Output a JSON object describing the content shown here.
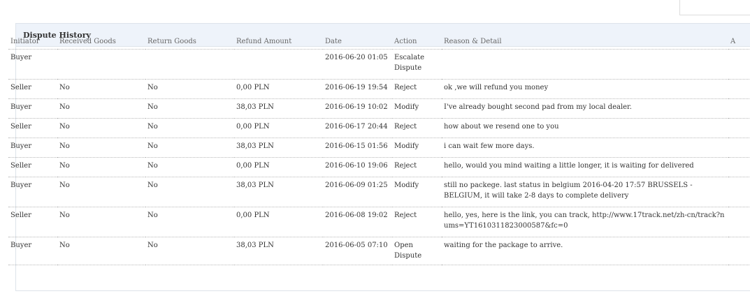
{
  "panel": {
    "title": "Dispute History"
  },
  "columns": [
    "Initiator",
    "Received Goods",
    "Return Goods",
    "Refund Amount",
    "Date",
    "Action",
    "Reason & Detail",
    "A"
  ],
  "rows": [
    {
      "initiator": "Buyer",
      "received": "",
      "returned": "",
      "refund": "",
      "date": "2016-06-20 01:05",
      "action": "Escalate Dispute",
      "reason": ""
    },
    {
      "initiator": "Seller",
      "received": "No",
      "returned": "No",
      "refund": "0,00 PLN",
      "date": "2016-06-19 19:54",
      "action": "Reject",
      "reason": "ok ,we will refund you money"
    },
    {
      "initiator": "Buyer",
      "received": "No",
      "returned": "No",
      "refund": "38,03 PLN",
      "date": "2016-06-19 10:02",
      "action": "Modify",
      "reason": "I've already bought second pad from my local dealer."
    },
    {
      "initiator": "Seller",
      "received": "No",
      "returned": "No",
      "refund": "0,00 PLN",
      "date": "2016-06-17 20:44",
      "action": "Reject",
      "reason": "how about we resend one to you"
    },
    {
      "initiator": "Buyer",
      "received": "No",
      "returned": "No",
      "refund": "38,03 PLN",
      "date": "2016-06-15 01:56",
      "action": "Modify",
      "reason": "i can wait few more days."
    },
    {
      "initiator": "Seller",
      "received": "No",
      "returned": "No",
      "refund": "0,00 PLN",
      "date": "2016-06-10 19:06",
      "action": "Reject",
      "reason": "hello, would you mind waiting a little longer, it is waiting for delivered"
    },
    {
      "initiator": "Buyer",
      "received": "No",
      "returned": "No",
      "refund": "38,03 PLN",
      "date": "2016-06-09 01:25",
      "action": "Modify",
      "reason": "still no packege. last status in belgium 2016-04-20 17:57 BRUSSELS - BELGIUM, it will take 2-8 days to complete delivery"
    },
    {
      "initiator": "Seller",
      "received": "No",
      "returned": "No",
      "refund": "0,00 PLN",
      "date": "2016-06-08 19:02",
      "action": "Reject",
      "reason": "hello, yes, here is the link, you can track, http://www.17track.net/zh-cn/track?nums=YT1610311823000587&fc=0"
    },
    {
      "initiator": "Buyer",
      "received": "No",
      "returned": "No",
      "refund": "38,03 PLN",
      "date": "2016-06-05 07:10",
      "action": "Open Dispute",
      "reason": "waiting for the package to arrive."
    }
  ]
}
